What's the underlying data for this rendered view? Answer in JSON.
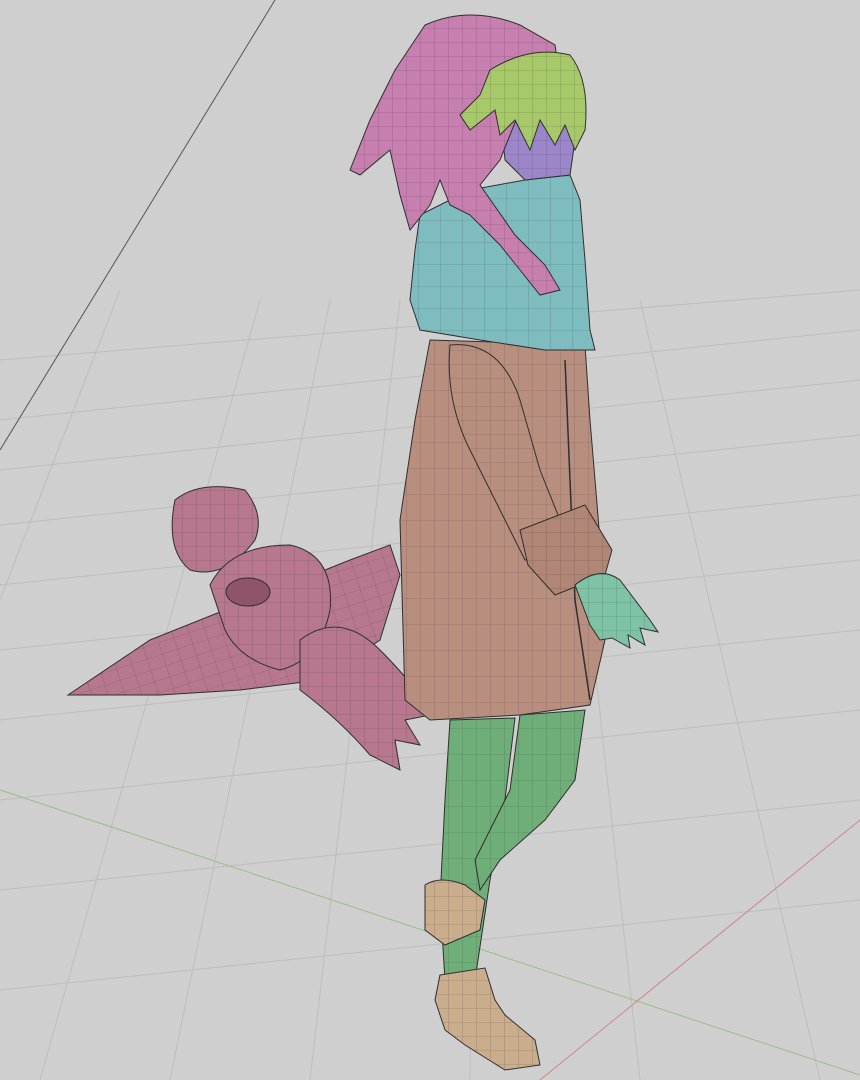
{
  "viewport": {
    "background": "#cfcfcf",
    "grid_color": "#bdbdbd",
    "axis_x_color": "#c98a8a",
    "axis_y_color": "#9bbf7d",
    "wire_color": "#3a3a3a"
  },
  "model": {
    "materials": {
      "hair": "#c77fb0",
      "hair_bangs": "#a8c96a",
      "face": "#9a86c9",
      "scarf": "#7fbcc0",
      "coat": "#b88f7f",
      "cuff": "#b08676",
      "hand": "#7fc3a6",
      "stockings": "#6fae78",
      "boots": "#c9ad8c",
      "bow": "#b7788f"
    }
  }
}
